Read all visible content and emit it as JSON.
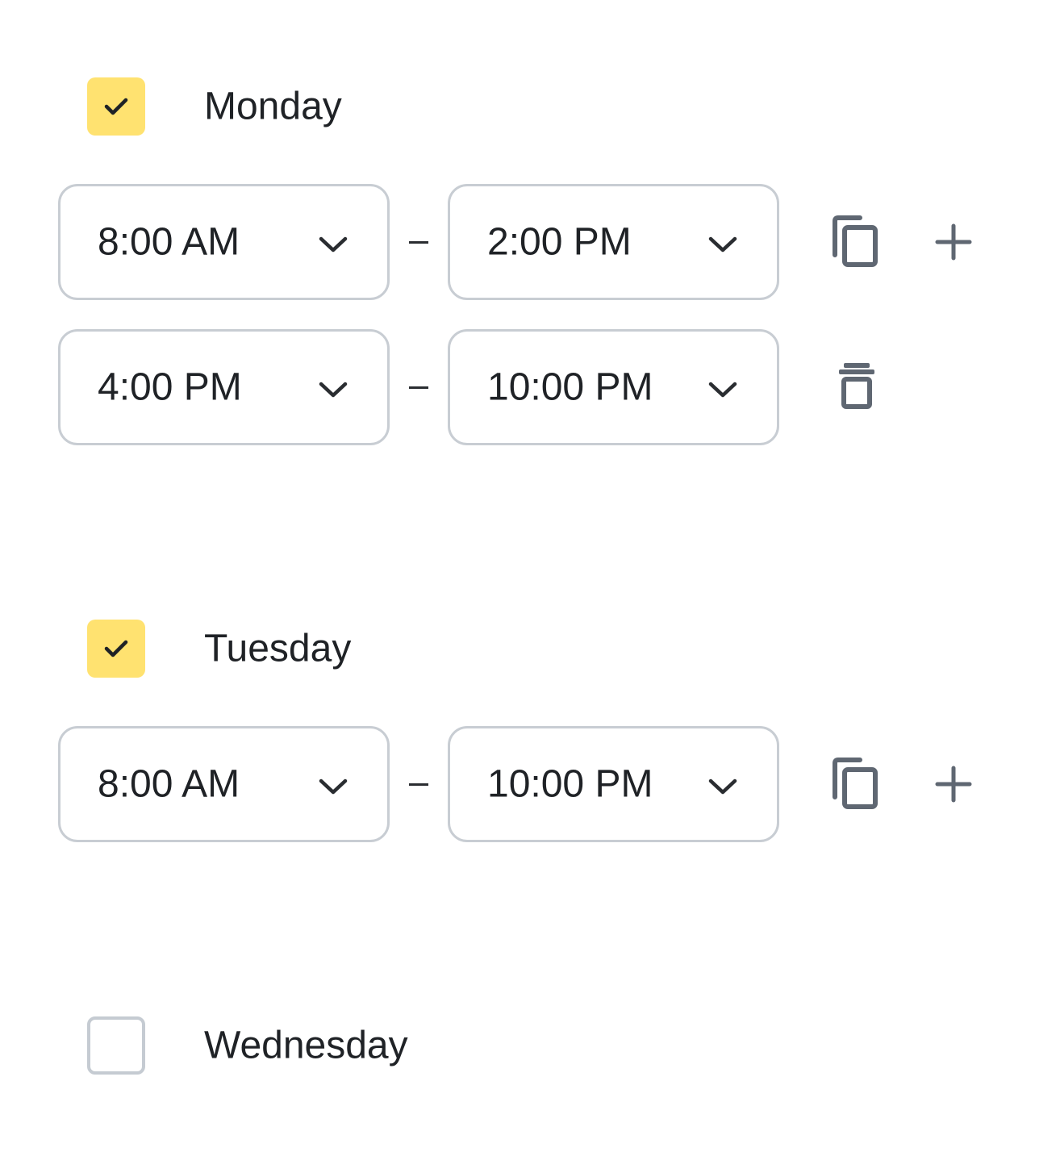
{
  "days": [
    {
      "name": "Monday",
      "checked": true,
      "slots": [
        {
          "start": "8:00 AM",
          "end": "2:00 PM",
          "actions": [
            "copy-icon",
            "plus-icon"
          ]
        },
        {
          "start": "4:00 PM",
          "end": "10:00 PM",
          "actions": [
            "trash-icon"
          ]
        }
      ]
    },
    {
      "name": "Tuesday",
      "checked": true,
      "slots": [
        {
          "start": "8:00 AM",
          "end": "10:00 PM",
          "actions": [
            "copy-icon",
            "plus-icon"
          ]
        }
      ]
    },
    {
      "name": "Wednesday",
      "checked": false,
      "slots": []
    }
  ],
  "colors": {
    "checkbox_checked": "#ffe270",
    "checkbox_border": "#c5cbd2",
    "field_border": "#c8cdd3",
    "icon": "#5f6772",
    "text": "#1f2226"
  }
}
